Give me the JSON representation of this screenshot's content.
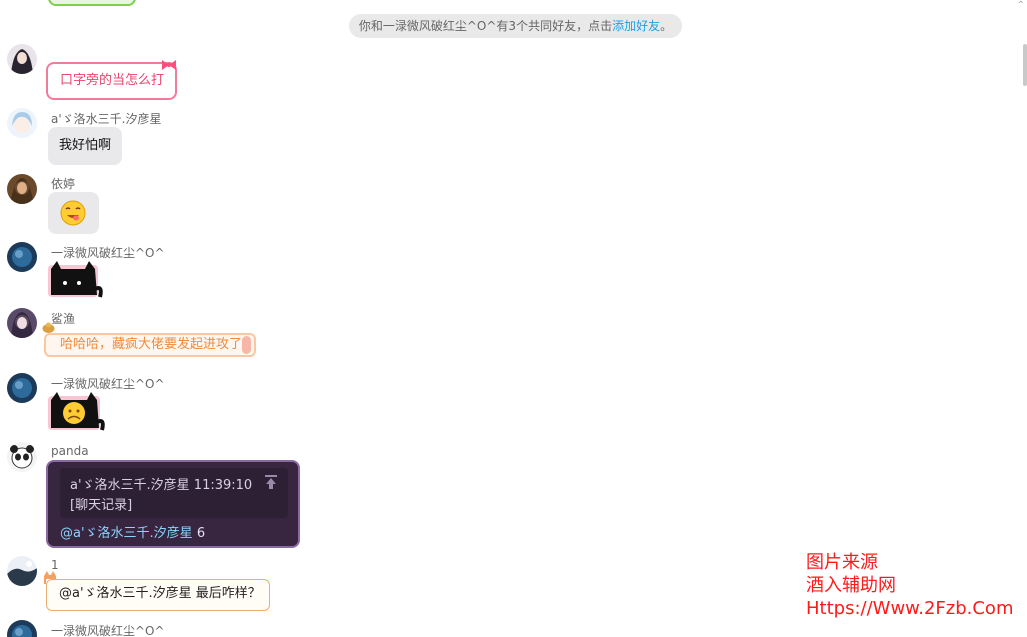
{
  "system_notice": {
    "text": "你和一渌微风破红尘^O^有3个共同好友，点击",
    "link": "添加好友",
    "suffix": "。"
  },
  "messages": [
    {
      "sender": "",
      "text": "口字旁的当怎么打"
    },
    {
      "sender": "a'ゞ洛水三千.汐彦星",
      "text": "我好怕啊"
    },
    {
      "sender": "依婷",
      "text": ""
    },
    {
      "sender": "一渌微风破红尘^O^",
      "text": ""
    },
    {
      "sender": "鲨渔",
      "text": "哈哈哈，藏疯大佬要发起进攻了"
    },
    {
      "sender": "一渌微风破红尘^O^",
      "text": ""
    },
    {
      "sender": "panda",
      "quote_author_time": "a'ゞ洛水三千.汐彦星   11:39:10",
      "quote_body": "[聊天记录]",
      "reply_mention": "@a'ゞ洛水三千.汐彦星",
      "reply_text": " 6"
    },
    {
      "sender": "1",
      "text": "@a'ゞ洛水三千.汐彦星 最后咋样？"
    },
    {
      "sender": "一渌微风破红尘^O^",
      "text": ""
    }
  ],
  "watermark": {
    "line1": "图片来源",
    "line2": "酒入辅助网",
    "line3": "Https://Www.2Fzb.Com"
  },
  "colors": {
    "link": "#1aa1e8",
    "pink_bubble": "#f07c9b",
    "dark_bubble": "#38253f",
    "watermark": "#ff1a1a"
  },
  "icons": {
    "emoji_yum": "face-savoring-emoji",
    "pin": "pin-top-icon",
    "bow": "bow-decoration-icon"
  }
}
